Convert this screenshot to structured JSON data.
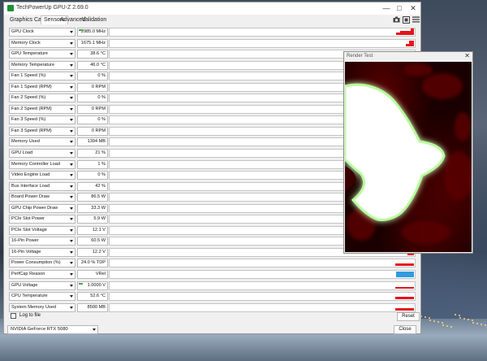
{
  "window": {
    "title": "TechPowerUp GPU-Z 2.69.0",
    "controls": {
      "minimize": "—",
      "maximize": "□",
      "close": "✕"
    }
  },
  "tabs": [
    "Graphics Card",
    "Sensors",
    "Advanced",
    "Validation"
  ],
  "active_tab": "Sensors",
  "toolbar_icons": [
    "camera-icon",
    "refresh-icon",
    "menu-icon"
  ],
  "sensors": [
    {
      "label": "GPU Clock",
      "value": "2985.0 MHz",
      "flag": true
    },
    {
      "label": "Memory Clock",
      "value": "1675.1 MHz"
    },
    {
      "label": "GPU Temperature",
      "value": "38.6 °C"
    },
    {
      "label": "Memory Temperature",
      "value": "46.0 °C"
    },
    {
      "label": "Fan 1 Speed (%)",
      "value": "0 %"
    },
    {
      "label": "Fan 1 Speed (RPM)",
      "value": "0 RPM"
    },
    {
      "label": "Fan 2 Speed (%)",
      "value": "0 %"
    },
    {
      "label": "Fan 2 Speed (RPM)",
      "value": "0 RPM"
    },
    {
      "label": "Fan 3 Speed (%)",
      "value": "0 %"
    },
    {
      "label": "Fan 3 Speed (RPM)",
      "value": "0 RPM"
    },
    {
      "label": "Memory Used",
      "value": "1394 MB"
    },
    {
      "label": "GPU Load",
      "value": "21 %"
    },
    {
      "label": "Memory Controller Load",
      "value": "1 %"
    },
    {
      "label": "Video Engine Load",
      "value": "0 %"
    },
    {
      "label": "Bus Interface Load",
      "value": "42 %"
    },
    {
      "label": "Board Power Draw",
      "value": "86.5 W"
    },
    {
      "label": "GPU Chip Power Draw",
      "value": "33.3 W"
    },
    {
      "label": "PCIe Slot Power",
      "value": "5.9 W"
    },
    {
      "label": "PCIe Slot Voltage",
      "value": "12.1 V"
    },
    {
      "label": "16-Pin Power",
      "value": "60.5 W"
    },
    {
      "label": "16-Pin Voltage",
      "value": "12.2 V"
    },
    {
      "label": "Power Consumption (%)",
      "value": "24.0 % TDP"
    },
    {
      "label": "PerfCap Reason",
      "value": "VRel"
    },
    {
      "label": "GPU Voltage",
      "value": "1.0000 V",
      "flag": true
    },
    {
      "label": "CPU Temperature",
      "value": "52.6 °C"
    },
    {
      "label": "System Memory Used",
      "value": "8500 MB"
    }
  ],
  "bottom": {
    "log_label": "Log to file",
    "log_checked": false,
    "reset_label": "Reset",
    "gpu_name": "NVIDIA GeForce RTX 5080",
    "close_label": "Close"
  },
  "render_test": {
    "title": "Render Test",
    "close": "✕"
  },
  "colors": {
    "graph_red": "#e8121a",
    "graph_blue": "#2f9be0",
    "flag_green": "#48a848"
  }
}
